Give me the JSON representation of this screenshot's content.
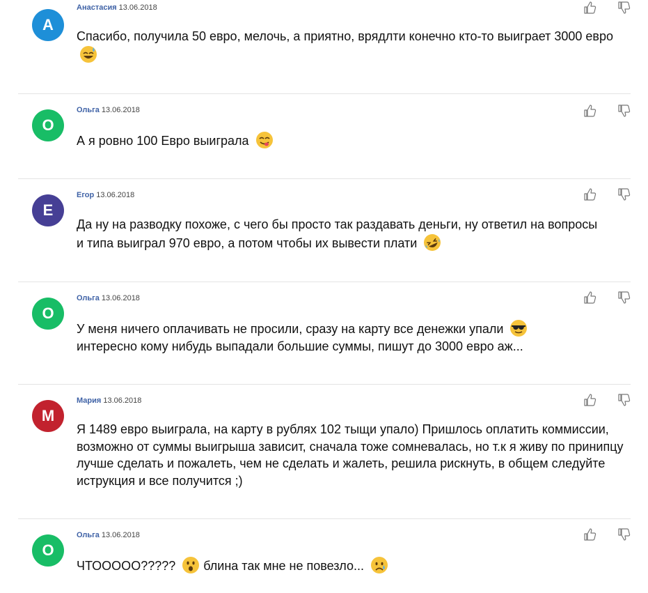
{
  "comments": [
    {
      "author": "Анастасия",
      "date": "13.06.2018",
      "avatar_letter": "А",
      "avatar_color": "#1e8fd8",
      "text_main": "Спасибо, получила 50 евро, мелочь, а приятно, врядлти конечно кто-то выиграет 3000 евро",
      "emoji": "sweat-smile",
      "text_after": ""
    },
    {
      "author": "Ольга",
      "date": "13.06.2018",
      "avatar_letter": "О",
      "avatar_color": "#18bd66",
      "text_main": "А я ровно 100 Евро выиграла",
      "emoji": "yum",
      "text_after": ""
    },
    {
      "author": "Егор",
      "date": "13.06.2018",
      "avatar_letter": "Е",
      "avatar_color": "#463f95",
      "text_main": "Да ну на разводку похоже, с чего бы просто так раздавать деньги, ну ответил на вопросы и типа выиграл 970 евро, а потом чтобы их вывести плати",
      "emoji": "rofl",
      "text_after": ""
    },
    {
      "author": "Ольга",
      "date": "13.06.2018",
      "avatar_letter": "О",
      "avatar_color": "#18bd66",
      "text_main": "У меня ничего оплачивать не просили, сразу на карту все денежки упали",
      "emoji": "sunglasses",
      "text_after": "интересно кому нибудь выпадали большие суммы, пишут до 3000 евро аж..."
    },
    {
      "author": "Мария",
      "date": "13.06.2018",
      "avatar_letter": "М",
      "avatar_color": "#c2222e",
      "text_main": "Я 1489 евро выиграла, на карту в рублях 102 тыщи упало) Пришлось оплатить коммиссии, возможно от суммы выигрыша зависит, сначала тоже сомневалась, но т.к я живу по принипцу лучше сделать и пожалеть, чем не сделать и жалеть, решила рискнуть, в общем следуйте иструкция и все получится ;)",
      "emoji": "",
      "text_after": ""
    },
    {
      "author": "Ольга",
      "date": "13.06.2018",
      "avatar_letter": "О",
      "avatar_color": "#18bd66",
      "text_main": "ЧТОООOO?????",
      "emoji": "hushed",
      "text_after": "блина так мне не повезло...",
      "emoji_end": "sad-tear"
    }
  ],
  "icons": {
    "like": "thumbs-up-icon",
    "dislike": "thumbs-down-icon"
  }
}
